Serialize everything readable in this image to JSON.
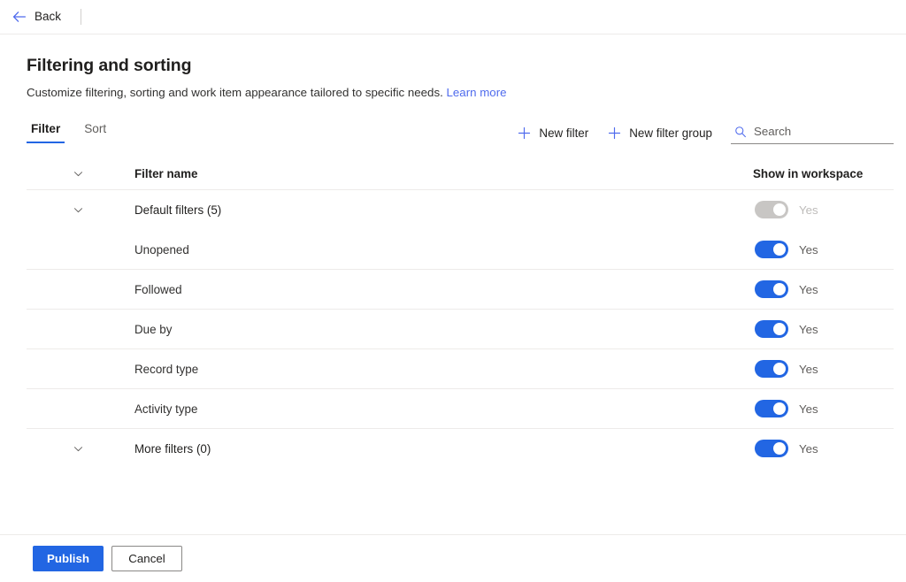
{
  "topbar": {
    "back_label": "Back",
    "back_icon": "arrow-left-icon",
    "accent": "#4f6bed"
  },
  "header": {
    "title": "Filtering and sorting",
    "subtitle": "Customize filtering, sorting and work item appearance tailored to specific needs.",
    "learn_more_label": "Learn more"
  },
  "tabs": [
    {
      "label": "Filter",
      "active": true
    },
    {
      "label": "Sort",
      "active": false
    }
  ],
  "toolbar": {
    "new_filter_label": "New filter",
    "new_filter_group_label": "New filter group",
    "add_icon": "plus-icon",
    "search": {
      "icon": "search-icon",
      "placeholder": "Search",
      "value": ""
    }
  },
  "table": {
    "columns": {
      "name": "Filter name",
      "toggle": "Show in workspace"
    },
    "expand_icon": "chevron-down-icon",
    "rows": [
      {
        "label": "Default filters (5)",
        "level": 0,
        "has_chevron": true,
        "toggle_on": true,
        "toggle_disabled": true,
        "toggle_label": "Yes",
        "rule": false
      },
      {
        "label": "Unopened",
        "level": 1,
        "has_chevron": false,
        "toggle_on": true,
        "toggle_disabled": false,
        "toggle_label": "Yes",
        "rule": true
      },
      {
        "label": "Followed",
        "level": 1,
        "has_chevron": false,
        "toggle_on": true,
        "toggle_disabled": false,
        "toggle_label": "Yes",
        "rule": true
      },
      {
        "label": "Due by",
        "level": 1,
        "has_chevron": false,
        "toggle_on": true,
        "toggle_disabled": false,
        "toggle_label": "Yes",
        "rule": true
      },
      {
        "label": "Record type",
        "level": 1,
        "has_chevron": false,
        "toggle_on": true,
        "toggle_disabled": false,
        "toggle_label": "Yes",
        "rule": true
      },
      {
        "label": "Activity type",
        "level": 1,
        "has_chevron": false,
        "toggle_on": true,
        "toggle_disabled": false,
        "toggle_label": "Yes",
        "rule": true
      },
      {
        "label": "More filters (0)",
        "level": 0,
        "has_chevron": true,
        "toggle_on": true,
        "toggle_disabled": false,
        "toggle_label": "Yes",
        "rule": false
      }
    ]
  },
  "footer": {
    "publish_label": "Publish",
    "cancel_label": "Cancel"
  },
  "colors": {
    "accent_blue": "#2266e3",
    "link_blue": "#4f6bed",
    "toggle_off_gray": "#c8c6c4",
    "rule_gray": "#edebe9"
  }
}
